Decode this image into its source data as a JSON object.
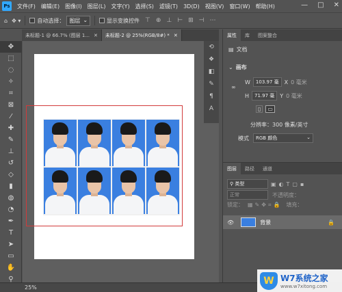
{
  "menubar": {
    "logo": "Ps",
    "items": [
      "文件(F)",
      "编辑(E)",
      "图像(I)",
      "图层(L)",
      "文字(Y)",
      "选择(S)",
      "滤镜(T)",
      "3D(D)",
      "视图(V)",
      "窗口(W)",
      "帮助(H)"
    ],
    "controls": [
      "—",
      "□",
      "✕"
    ]
  },
  "optionsbar": {
    "auto_select_label": "自动选择：",
    "auto_select_value": "图层",
    "show_transform_label": "显示变换控件"
  },
  "tabs": [
    {
      "label": "未标题-1 @ 66.7% (图层 1...",
      "close": "✕"
    },
    {
      "label": "未标题-2 @ 25%(RGB/8#) *",
      "close": "✕"
    }
  ],
  "statusbar": {
    "zoom": "25%"
  },
  "properties": {
    "tabs": [
      "属性",
      "库",
      "图案整合"
    ],
    "doc_label": "文档",
    "section": "画布",
    "w_label": "W",
    "w_value": "103.97 毫",
    "x_label": "X",
    "x_value": "0 毫米",
    "h_label": "H",
    "h_value": "71.97 毫",
    "y_label": "Y",
    "y_value": "0 毫米",
    "resolution": "分辨率：300 像素/英寸",
    "mode_label": "模式",
    "mode_value": "RGB 颜色"
  },
  "layers": {
    "tabs": [
      "图层",
      "路径",
      "通道"
    ],
    "filter_label": "类型",
    "blend_mode": "正常",
    "opacity_label": "不透明度：",
    "lock_label": "锁定：",
    "fill_label": "填充：",
    "layer_name": "背景"
  },
  "watermark": {
    "logo_text": "W",
    "title": "W7系统之家",
    "url": "www.w7xitong.com"
  }
}
